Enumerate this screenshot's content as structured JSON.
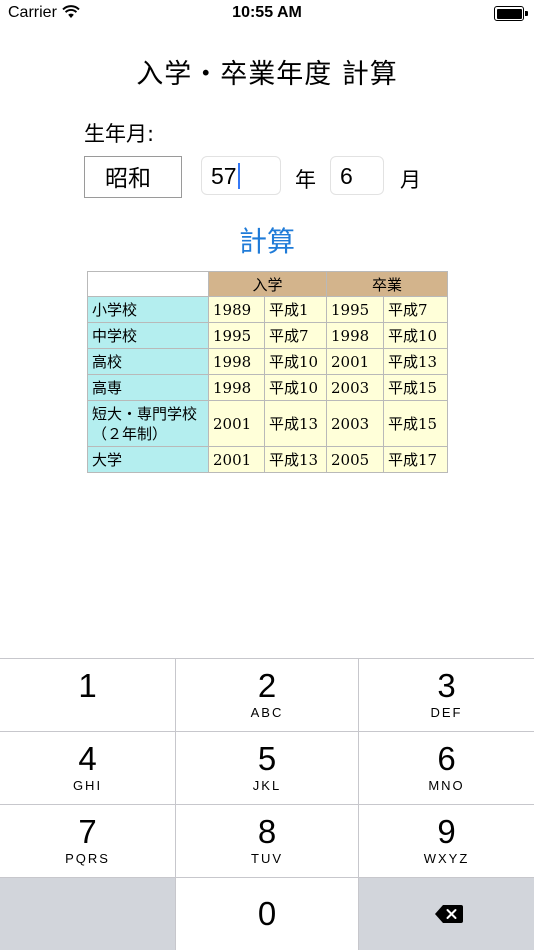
{
  "status_bar": {
    "carrier": "Carrier",
    "time": "10:55 AM"
  },
  "title": "入学・卒業年度 計算",
  "form": {
    "birth_label": "生年月:",
    "era": "昭和",
    "year_value": "57",
    "year_unit": "年",
    "month_value": "6",
    "month_unit": "月"
  },
  "calc_button": "計算",
  "table": {
    "headers": [
      "入学",
      "卒業"
    ],
    "rows": [
      {
        "school": "小学校",
        "enter_year": "1989",
        "enter_era": "平成1",
        "grad_year": "1995",
        "grad_era": "平成7"
      },
      {
        "school": "中学校",
        "enter_year": "1995",
        "enter_era": "平成7",
        "grad_year": "1998",
        "grad_era": "平成10"
      },
      {
        "school": "高校",
        "enter_year": "1998",
        "enter_era": "平成10",
        "grad_year": "2001",
        "grad_era": "平成13"
      },
      {
        "school": "高専",
        "enter_year": "1998",
        "enter_era": "平成10",
        "grad_year": "2003",
        "grad_era": "平成15"
      },
      {
        "school": "短大・専門学校（２年制）",
        "enter_year": "2001",
        "enter_era": "平成13",
        "grad_year": "2003",
        "grad_era": "平成15"
      },
      {
        "school": "大学",
        "enter_year": "2001",
        "enter_era": "平成13",
        "grad_year": "2005",
        "grad_era": "平成17"
      }
    ]
  },
  "keypad": {
    "keys": [
      {
        "digit": "1",
        "letters": ""
      },
      {
        "digit": "2",
        "letters": "ABC"
      },
      {
        "digit": "3",
        "letters": "DEF"
      },
      {
        "digit": "4",
        "letters": "GHI"
      },
      {
        "digit": "5",
        "letters": "JKL"
      },
      {
        "digit": "6",
        "letters": "MNO"
      },
      {
        "digit": "7",
        "letters": "PQRS"
      },
      {
        "digit": "8",
        "letters": "TUV"
      },
      {
        "digit": "9",
        "letters": "WXYZ"
      },
      {
        "digit": "0",
        "letters": ""
      }
    ],
    "delete_icon": "delete-backspace-icon"
  },
  "colors": {
    "accent": "#1f7bd8",
    "header_bg": "#d3b48c",
    "school_bg": "#b4eeef",
    "value_bg": "#ffffd9",
    "keypad_gray": "#d2d5db"
  }
}
